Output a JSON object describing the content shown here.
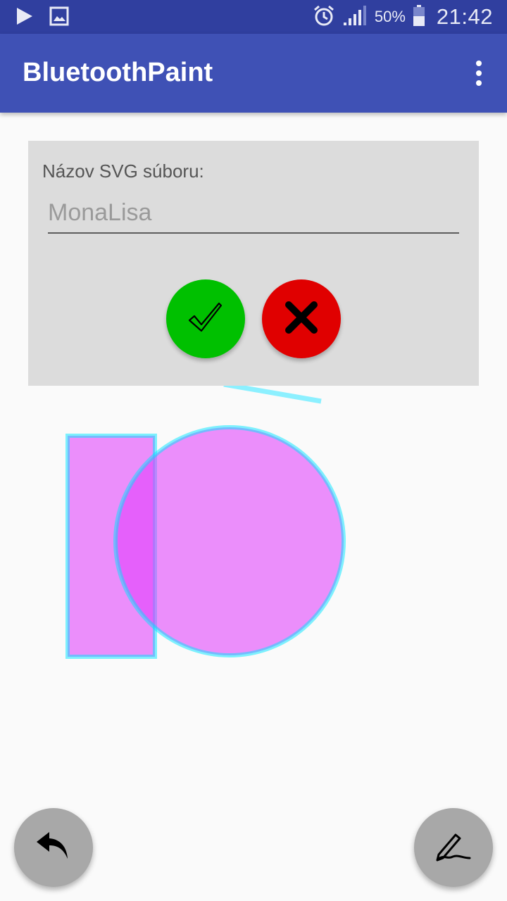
{
  "status_bar": {
    "battery_percent": "50%",
    "time": "21:42",
    "icons": [
      "play-store-icon",
      "gallery-icon",
      "alarm-icon",
      "signal-icon",
      "battery-icon"
    ]
  },
  "app_bar": {
    "title": "BluetoothPaint",
    "menu_icon": "overflow-menu-icon"
  },
  "dialog": {
    "label": "Názov SVG súboru:",
    "input_value": "",
    "input_placeholder": "MonaLisa",
    "confirm_icon": "check-icon",
    "cancel_icon": "close-icon",
    "confirm_color": "#00c000",
    "cancel_color": "#e00000"
  },
  "drawing": {
    "shapes": [
      "line",
      "rectangle",
      "circle"
    ],
    "fill_color": "#e88cf8",
    "stroke_color": "#8cf0ff"
  },
  "fabs": {
    "undo_icon": "undo-icon",
    "draw_icon": "pen-icon"
  }
}
